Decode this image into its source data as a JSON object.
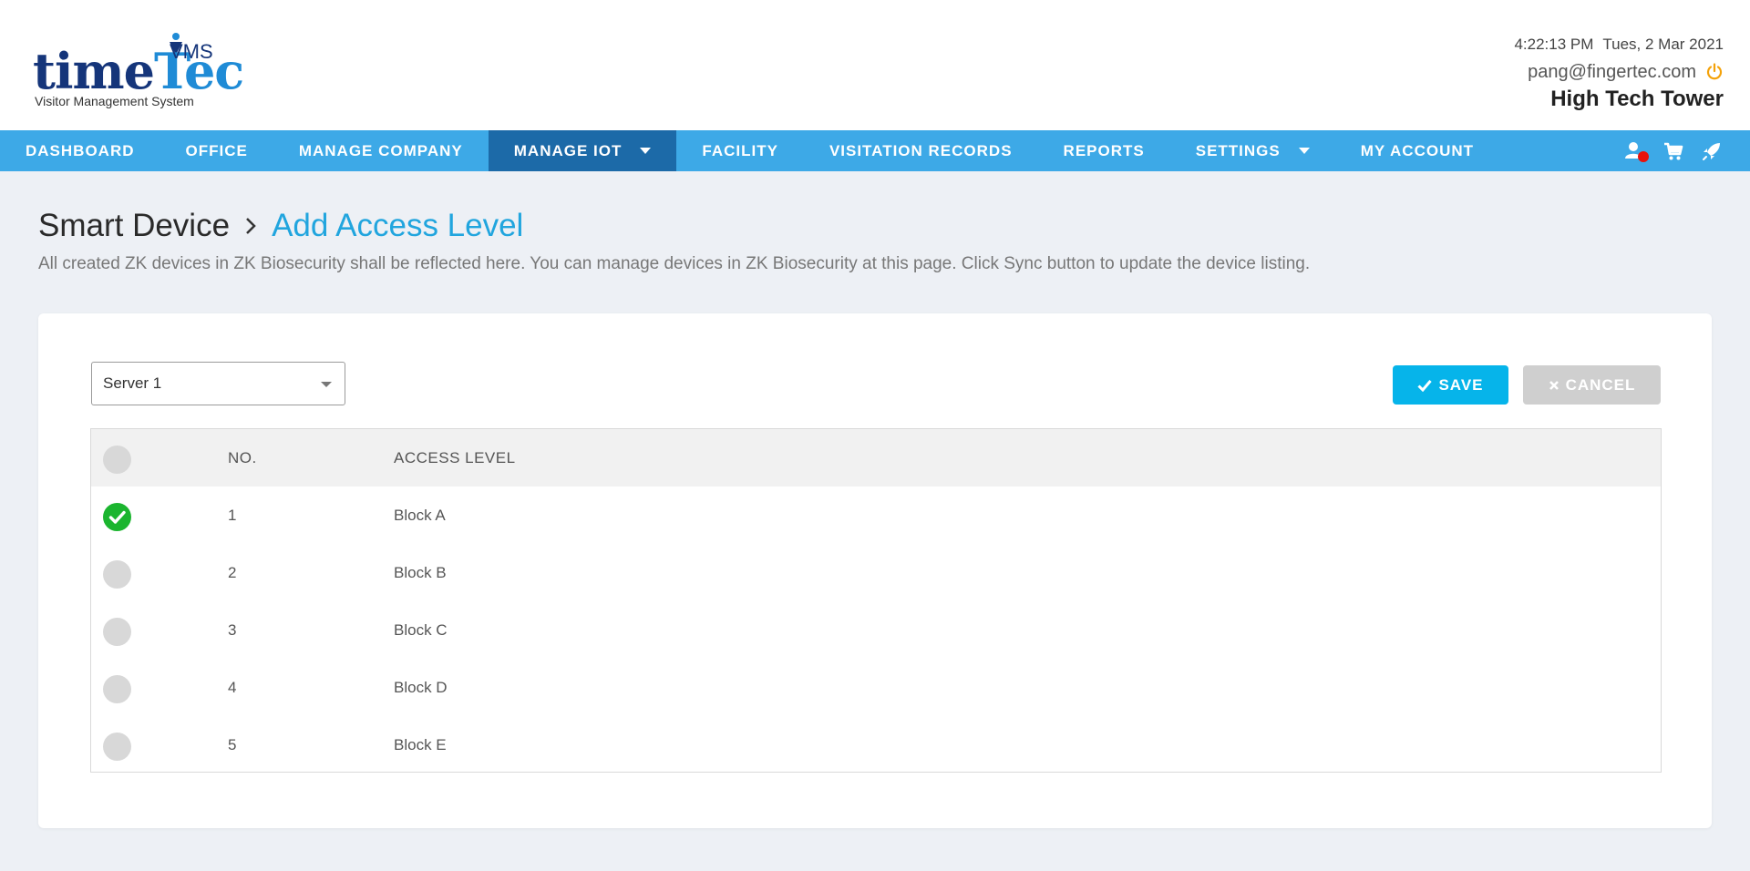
{
  "header": {
    "logo": {
      "time": "time",
      "tec": "Tec",
      "vms": "VMS",
      "subtitle": "Visitor Management System"
    },
    "time": "4:22:13 PM",
    "date": "Tues, 2 Mar 2021",
    "user_email": "pang@fingertec.com",
    "company": "High Tech Tower"
  },
  "nav": {
    "items": [
      {
        "label": "DASHBOARD"
      },
      {
        "label": "OFFICE"
      },
      {
        "label": "MANAGE COMPANY"
      },
      {
        "label": "MANAGE IOT",
        "active": true,
        "dropdown": true
      },
      {
        "label": "FACILITY"
      },
      {
        "label": "VISITATION RECORDS"
      },
      {
        "label": "REPORTS"
      },
      {
        "label": "SETTINGS",
        "dropdown": true
      },
      {
        "label": "MY ACCOUNT"
      }
    ],
    "icons": [
      "user-notification-icon",
      "cart-icon",
      "rocket-icon"
    ]
  },
  "breadcrumb": {
    "parent": "Smart Device",
    "current": "Add Access Level"
  },
  "description": "All created ZK devices in ZK Biosecurity shall be reflected here. You can manage devices in ZK Biosecurity at this page. Click Sync button to update the device listing.",
  "server_select": {
    "value": "Server 1"
  },
  "buttons": {
    "save": "SAVE",
    "cancel": "CANCEL"
  },
  "table": {
    "headers": {
      "no": "NO.",
      "access_level": "ACCESS LEVEL"
    },
    "rows": [
      {
        "no": "1",
        "access_level": "Block A",
        "checked": true
      },
      {
        "no": "2",
        "access_level": "Block B",
        "checked": false
      },
      {
        "no": "3",
        "access_level": "Block C",
        "checked": false
      },
      {
        "no": "4",
        "access_level": "Block D",
        "checked": false
      },
      {
        "no": "5",
        "access_level": "Block E",
        "checked": false
      }
    ]
  },
  "colors": {
    "nav": "#3da9e7",
    "nav_active": "#1c6aa8",
    "accent": "#21a5de",
    "save": "#06b4ea",
    "check": "#1bb52f"
  }
}
